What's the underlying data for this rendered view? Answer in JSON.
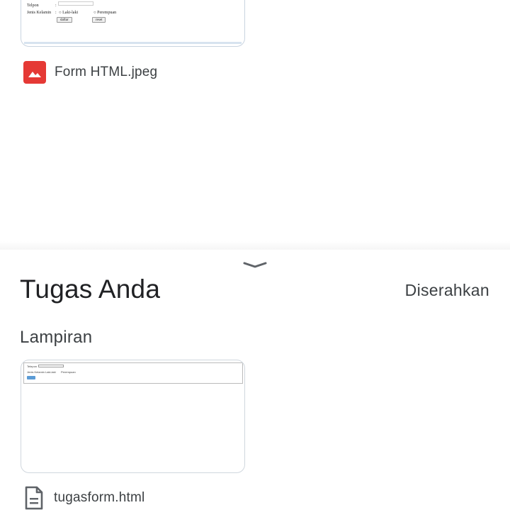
{
  "top_attachment": {
    "preview": {
      "phone_label": "Telpon",
      "gender_label": "Jenis Kelamin",
      "separator": ":",
      "option_male": "Laki-laki",
      "option_female": "Perempuan",
      "submit_label": "daftar",
      "reset_label": "reset"
    },
    "file_name": "Form HTML.jpeg",
    "file_icon": "image-icon"
  },
  "sheet": {
    "handle_icon": "chevron-down-icon",
    "title": "Tugas Anda",
    "status": "Diserahkan",
    "section_title": "Lampiran"
  },
  "bottom_attachment": {
    "preview": {
      "phone_label": "Telepon",
      "gender_label": "Jenis Kelamin",
      "option_male": "Laki-laki",
      "option_female": "Perempuan"
    },
    "file_name": "tugasform.html",
    "file_icon": "document-icon"
  },
  "colors": {
    "image_icon": "#e53935",
    "doc_icon": "#5f6368",
    "preview_button": "#5b9bd5"
  }
}
